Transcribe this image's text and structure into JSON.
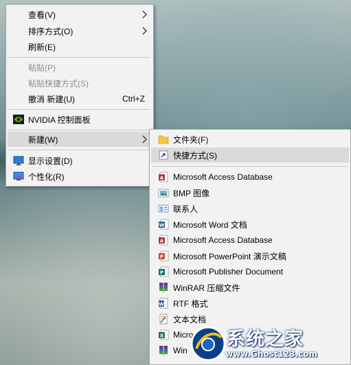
{
  "main_menu": {
    "items": [
      {
        "label": "查看(V)"
      },
      {
        "label": "排序方式(O)"
      },
      {
        "label": "刷新(E)"
      },
      {
        "label": "粘贴(P)"
      },
      {
        "label": "粘贴快捷方式(S)"
      },
      {
        "label": "撤消 新建(U)",
        "shortcut": "Ctrl+Z"
      },
      {
        "label": "NVIDIA 控制面板"
      },
      {
        "label": "新建(W)"
      },
      {
        "label": "显示设置(D)"
      },
      {
        "label": "个性化(R)"
      }
    ]
  },
  "new_submenu": {
    "items": [
      {
        "label": "文件夹(F)"
      },
      {
        "label": "快捷方式(S)"
      },
      {
        "label": "Microsoft Access Database"
      },
      {
        "label": "BMP 图像"
      },
      {
        "label": "联系人"
      },
      {
        "label": "Microsoft Word 文档"
      },
      {
        "label": "Microsoft Access Database"
      },
      {
        "label": "Microsoft PowerPoint 演示文稿"
      },
      {
        "label": "Microsoft Publisher Document"
      },
      {
        "label": "WinRAR 压缩文件"
      },
      {
        "label": "RTF 格式"
      },
      {
        "label": "文本文档"
      },
      {
        "label": "Micro"
      },
      {
        "label": "Win"
      }
    ]
  },
  "watermark": {
    "title": "系统之家",
    "url": "www.Ghost123.com"
  },
  "colors": {
    "menu_bg": "#f2f2f2",
    "highlight": "#dadada",
    "disabled_text": "#8c8c8c",
    "separator": "#c8c8c8"
  }
}
